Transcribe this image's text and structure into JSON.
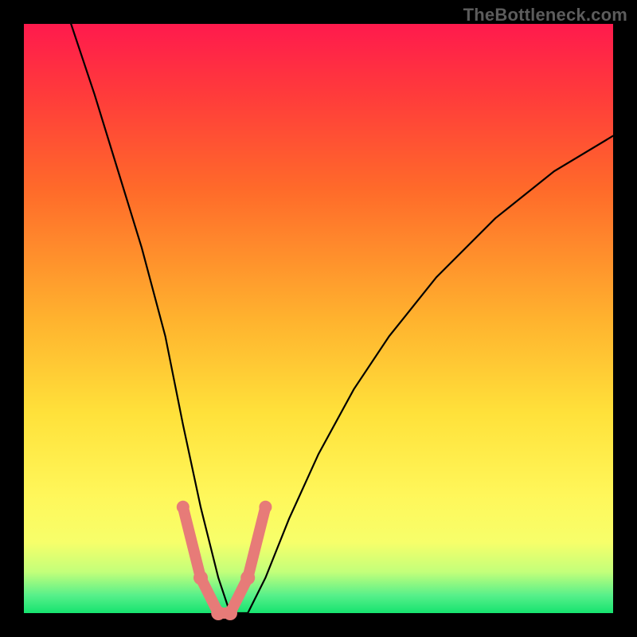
{
  "watermark": "TheBottleneck.com",
  "chart_data": {
    "type": "line",
    "title": "",
    "xlabel": "",
    "ylabel": "",
    "xlim": [
      0,
      100
    ],
    "ylim": [
      0,
      100
    ],
    "grid": false,
    "legend": false,
    "background_gradient": {
      "top": "#ff1a4d",
      "bottom": "#16e36f",
      "note": "red→orange→yellow→green vertical gradient"
    },
    "series": [
      {
        "name": "bottleneck-curve",
        "note": "V-shaped curve; y≈100 is top (red/bad), y≈0 is bottom (green/good). Minimum (optimal) around x≈35.",
        "x": [
          8,
          12,
          16,
          20,
          24,
          27,
          30,
          33,
          35,
          38,
          41,
          45,
          50,
          56,
          62,
          70,
          80,
          90,
          100
        ],
        "y": [
          100,
          88,
          75,
          62,
          47,
          32,
          18,
          6,
          0,
          0,
          6,
          16,
          27,
          38,
          47,
          57,
          67,
          75,
          81
        ]
      }
    ],
    "highlight_segment": {
      "note": "thick salmon segment with dots near the trough",
      "stroke": "#e77b78",
      "points_x": [
        27,
        30,
        33,
        35,
        38,
        41
      ],
      "points_y": [
        18,
        6,
        0,
        0,
        6,
        18
      ]
    }
  }
}
